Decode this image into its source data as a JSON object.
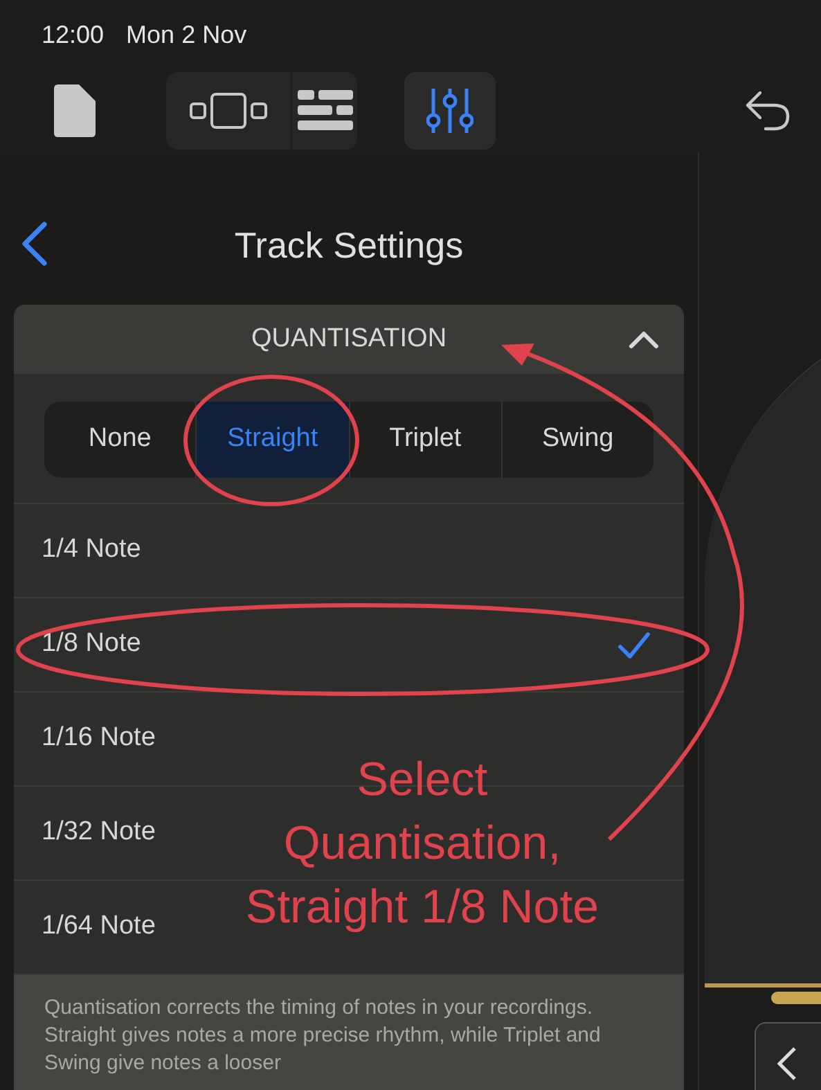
{
  "status_bar": {
    "time": "12:00",
    "date": "Mon 2 Nov"
  },
  "toolbar": [
    {
      "kind": "document",
      "selected": false
    },
    {
      "kind": "browser",
      "selected": false
    },
    {
      "kind": "tracks",
      "selected": false
    },
    {
      "kind": "mixer",
      "selected": true
    },
    {
      "kind": "undo",
      "selected": false
    }
  ],
  "panel": {
    "title": "Track Settings",
    "section": {
      "title": "QUANTISATION",
      "expanded": true,
      "modes": [
        {
          "label": "None",
          "selected": false
        },
        {
          "label": "Straight",
          "selected": true
        },
        {
          "label": "Triplet",
          "selected": false
        },
        {
          "label": "Swing",
          "selected": false
        }
      ],
      "notes": [
        {
          "label": "1/4 Note",
          "selected": false
        },
        {
          "label": "1/8 Note",
          "selected": true
        },
        {
          "label": "1/16 Note",
          "selected": false
        },
        {
          "label": "1/32 Note",
          "selected": false
        },
        {
          "label": "1/64 Note",
          "selected": false
        }
      ],
      "description": "Quantisation corrects the timing of notes in your recordings. Straight gives notes a more precise rhythm, while Triplet and Swing give notes a looser"
    }
  },
  "annotation": {
    "lines": [
      "Select",
      "Quantisation,",
      "Straight 1/8 Note"
    ]
  }
}
